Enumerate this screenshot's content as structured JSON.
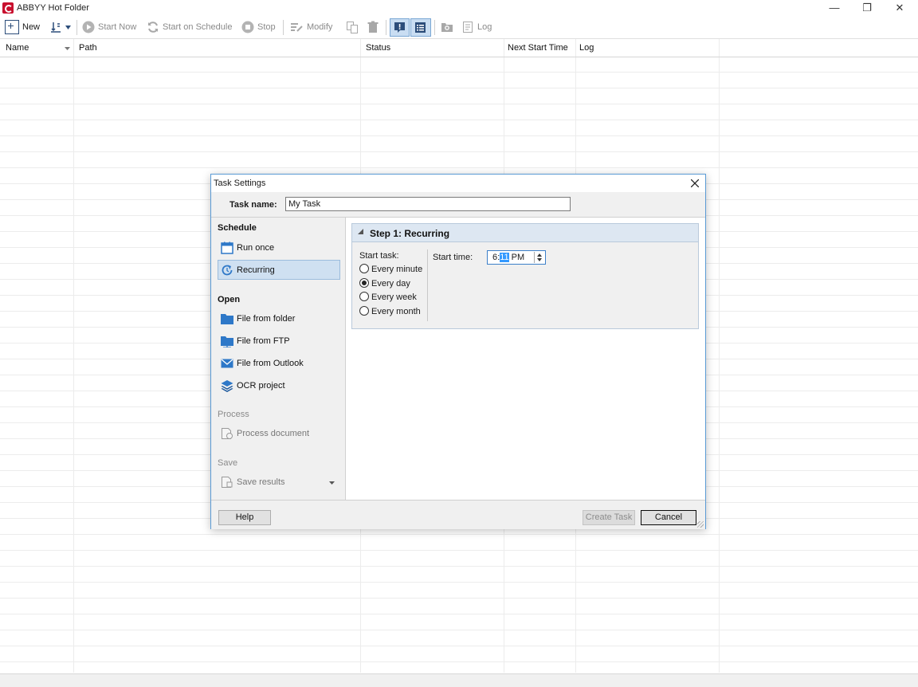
{
  "window": {
    "title": "ABBYY Hot Folder",
    "controls": {
      "minimize": "—",
      "maximize": "❐",
      "close": "✕"
    }
  },
  "toolbar": {
    "new_label": "New",
    "start_now_label": "Start Now",
    "start_on_schedule_label": "Start on Schedule",
    "stop_label": "Stop",
    "modify_label": "Modify",
    "log_label": "Log"
  },
  "table": {
    "columns": [
      "Name",
      "Path",
      "Status",
      "Next Start Time",
      "Log"
    ]
  },
  "dialog": {
    "title": "Task Settings",
    "task_name_label": "Task name:",
    "task_name_value": "My Task",
    "sections": {
      "schedule": "Schedule",
      "open": "Open",
      "process": "Process",
      "save": "Save"
    },
    "nav": {
      "run_once": "Run once",
      "recurring": "Recurring",
      "file_from_folder": "File from folder",
      "file_from_ftp": "File from FTP",
      "file_from_outlook": "File from Outlook",
      "ocr_project": "OCR project",
      "process_document": "Process document",
      "save_results": "Save results"
    },
    "step": {
      "title": "Step 1: Recurring",
      "start_task_label": "Start task:",
      "options": [
        "Every minute",
        "Every day",
        "Every week",
        "Every month"
      ],
      "selected": "Every day",
      "start_time_label": "Start time:",
      "start_time_hour": "6:",
      "start_time_minute": "11",
      "start_time_ampm": " PM"
    },
    "buttons": {
      "help": "Help",
      "create_task": "Create Task",
      "cancel": "Cancel"
    }
  },
  "colors": {
    "accent": "#2e78c8",
    "selection": "#cfe0f1",
    "dialog_border": "#5b9bd5"
  }
}
